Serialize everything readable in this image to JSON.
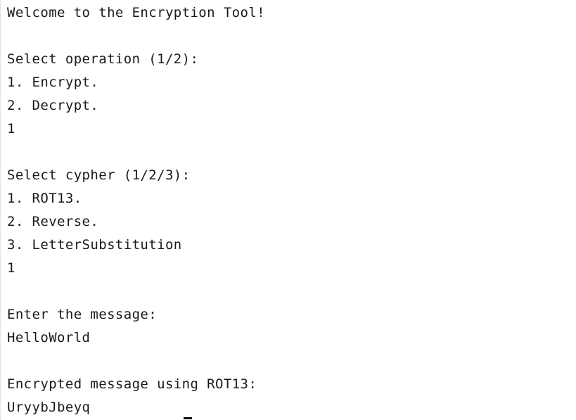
{
  "console": {
    "welcome": "Welcome to the Encryption Tool!",
    "operation_prompt": "Select operation (1/2):",
    "operation_options": [
      "1. Encrypt.",
      "2. Decrypt."
    ],
    "operation_input": "1",
    "cypher_prompt": "Select cypher (1/2/3):",
    "cypher_options": [
      "1. ROT13.",
      "2. Reverse.",
      "3. LetterSubstitution"
    ],
    "cypher_input": "1",
    "message_prompt": "Enter the message:",
    "message_input": "HelloWorld",
    "result_label": "Encrypted message using ROT13:",
    "result_value": "UryybJbeyq"
  }
}
